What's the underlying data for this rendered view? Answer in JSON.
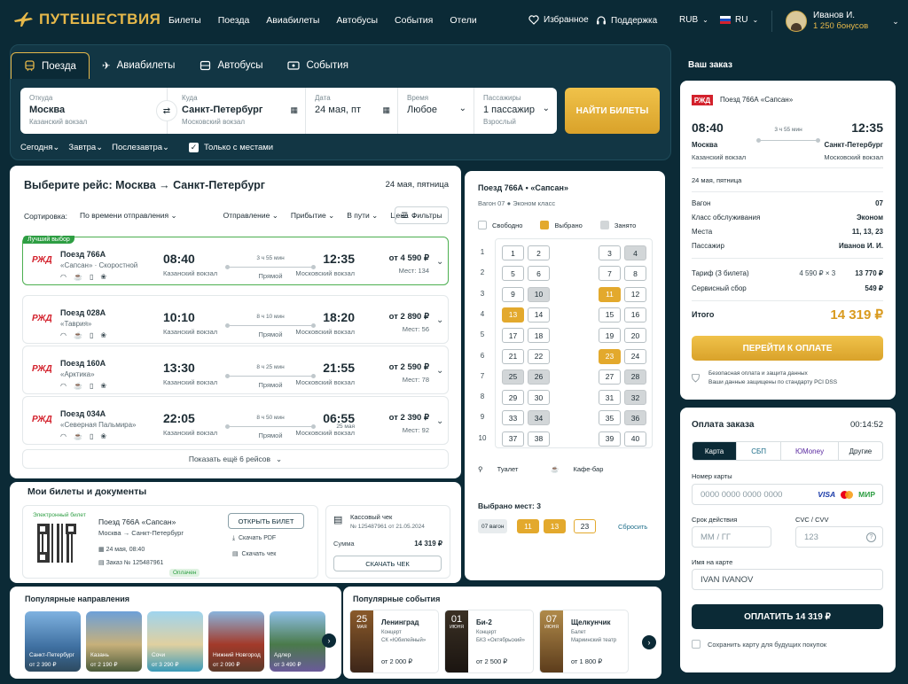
{
  "header": {
    "logo": "ПУТЕШЕСТВИЯ",
    "nav": [
      "Билеты",
      "Поезда",
      "Авиабилеты",
      "Автобусы",
      "События",
      "Отели"
    ],
    "favorites": "Избранное",
    "support": "Поддержка",
    "currency": "RUB",
    "lang": "RU",
    "user_name": "Иванов И.",
    "user_bonus": "1 250 бонусов"
  },
  "search": {
    "tabs": [
      "Поезда",
      "Авиабилеты",
      "Автобусы",
      "События"
    ],
    "from_label": "Откуда",
    "from": "Москва",
    "from_sub": "Казанский вокзал",
    "to_label": "Куда",
    "to": "Санкт-Петербург",
    "to_sub": "Московский вокзал",
    "date_label": "Дата",
    "date": "24 мая, пт",
    "time_label": "Время",
    "time": "Любое",
    "pass_label": "Пассажиры",
    "pass": "1 пассажир",
    "pass_sub": "Взрослый",
    "find": "НАЙТИ БИЛЕТЫ",
    "quick": [
      "Сегодня",
      "Завтра",
      "Послезавтра"
    ],
    "seats_only": "Только с местами"
  },
  "results": {
    "title": "Выберите рейс: Москва → Санкт-Петербург",
    "date": "24 мая, пятница",
    "sort_label": "Сортировка:",
    "sort_value": "По времени отправления",
    "sort_opts": [
      "Отправление",
      "Прибытие",
      "В пути",
      "Цена"
    ],
    "filters": "Фильтры",
    "best": "Лучший выбор",
    "trains": [
      {
        "name": "Поезд 766А",
        "sub": "«Сапсан» · Скоростной",
        "dep": "08:40",
        "dep_st": "Казанский вокзал",
        "dur": "3 ч 55 мин",
        "type": "Прямой",
        "arr": "12:35",
        "arr_day": "",
        "arr_st": "Московский вокзал",
        "price": "от 4 590 ₽",
        "seats": "Мест: 134"
      },
      {
        "name": "Поезд 028А",
        "sub": "«Таврия»",
        "dep": "10:10",
        "dep_st": "Казанский вокзал",
        "dur": "8 ч 10 мин",
        "type": "Прямой",
        "arr": "18:20",
        "arr_day": "",
        "arr_st": "Московский вокзал",
        "price": "от 2 890 ₽",
        "seats": "Мест: 56"
      },
      {
        "name": "Поезд 160А",
        "sub": "«Арктика»",
        "dep": "13:30",
        "dep_st": "Казанский вокзал",
        "dur": "8 ч 25 мин",
        "type": "Прямой",
        "arr": "21:55",
        "arr_day": "",
        "arr_st": "Московский вокзал",
        "price": "от 2 590 ₽",
        "seats": "Мест: 78"
      },
      {
        "name": "Поезд 034А",
        "sub": "«Северная Пальмира»",
        "dep": "22:05",
        "dep_st": "Казанский вокзал",
        "dur": "8 ч 50 мин",
        "type": "Прямой",
        "arr": "06:55",
        "arr_day": "25 мая",
        "arr_st": "Московский вокзал",
        "price": "от 2 390 ₽",
        "seats": "Мест: 92"
      }
    ],
    "more": "Показать ещё 6 рейсов"
  },
  "tickets": {
    "title": "Мои билеты и документы",
    "etk": "Электронный билет",
    "train": "Поезд 766А «Сапсан»",
    "route": "Москва → Санкт-Петербург",
    "when": "24 мая, 08:40",
    "order": "Заказ № 125487961",
    "status": "Оплачен",
    "open": "ОТКРЫТЬ БИЛЕТ",
    "pdf": "Скачать PDF",
    "check": "Скачать чек",
    "cash_title": "Кассовый чек",
    "cash_no": "№ 125487961 от 21.05.2024",
    "sum_label": "Сумма",
    "sum": "14 319 ₽",
    "cash_btn": "СКАЧАТЬ ЧЕК"
  },
  "popular": {
    "title": "Популярные направления",
    "items": [
      {
        "city": "Санкт-Петербург",
        "price": "от 2 390 ₽"
      },
      {
        "city": "Казань",
        "price": "от 2 190 ₽"
      },
      {
        "city": "Сочи",
        "price": "от 3 290 ₽"
      },
      {
        "city": "Нижний Новгород",
        "price": "от 2 090 ₽"
      },
      {
        "city": "Адлер",
        "price": "от 3 490 ₽"
      }
    ]
  },
  "events": {
    "title": "Популярные события",
    "items": [
      {
        "day": "25",
        "mon": "МАЯ",
        "name": "Ленинград",
        "kind": "Концерт",
        "place": "СК «Юбилейный»",
        "price": "от 2 000 ₽"
      },
      {
        "day": "01",
        "mon": "ИЮНЯ",
        "name": "Би-2",
        "kind": "Концерт",
        "place": "БКЗ «Октябрьский»",
        "price": "от 2 500 ₽"
      },
      {
        "day": "07",
        "mon": "ИЮНЯ",
        "name": "Щелкунчик",
        "kind": "Балет",
        "place": "Мариинский театр",
        "price": "от 1 800 ₽"
      }
    ]
  },
  "seatmap": {
    "title": "Поезд 766А • «Сапсан»",
    "car": "Вагон 07",
    "car_class": "Эконом класс",
    "legend": [
      "Свободно",
      "Выбрано",
      "Занято"
    ],
    "toilet": "Туалет",
    "cafe": "Кафе-бар",
    "selected_title": "Выбрано мест: 3",
    "car_chip": "07 вагон",
    "chosen": [
      "11",
      "13",
      "23"
    ],
    "reset": "Сбросить",
    "rows": [
      "1",
      "2",
      "3",
      "4",
      "5",
      "6",
      "7",
      "8",
      "9",
      "10"
    ],
    "left": [
      [
        "1",
        "2"
      ],
      [
        "5",
        "6"
      ],
      [
        "9",
        "10"
      ],
      [
        "13",
        "14"
      ],
      [
        "17",
        "18"
      ],
      [
        "21",
        "22"
      ],
      [
        "25",
        "26"
      ],
      [
        "29",
        "30"
      ],
      [
        "33",
        "34"
      ],
      [
        "37",
        "38"
      ]
    ],
    "right": [
      [
        "3",
        "4"
      ],
      [
        "7",
        "8"
      ],
      [
        "11",
        "12"
      ],
      [
        "15",
        "16"
      ],
      [
        "19",
        "20"
      ],
      [
        "23",
        "24"
      ],
      [
        "27",
        "28"
      ],
      [
        "31",
        "32"
      ],
      [
        "35",
        "36"
      ],
      [
        "39",
        "40"
      ]
    ],
    "busy": [
      "4",
      "10",
      "25",
      "26",
      "28",
      "32",
      "34",
      "36"
    ],
    "sel": [
      "11",
      "13",
      "23"
    ]
  },
  "order": {
    "title": "Ваш заказ",
    "train": "Поезд 766А «Сапсан»",
    "dep": "08:40",
    "arr": "12:35",
    "dur": "3 ч 55 мин",
    "from": "Москва",
    "from_st": "Казанский вокзал",
    "to": "Санкт-Петербург",
    "to_st": "Московский вокзал",
    "date": "24 мая, пятница",
    "lines": [
      {
        "k": "Вагон",
        "v": "07"
      },
      {
        "k": "Класс обслуживания",
        "v": "Эконом"
      },
      {
        "k": "Места",
        "v": "11, 13, 23"
      },
      {
        "k": "Пассажир",
        "v": "Иванов И. И."
      }
    ],
    "tariff_label": "Тариф (3 билета)",
    "tariff_calc": "4 590 ₽ × 3",
    "tariff": "13 770 ₽",
    "fee_label": "Сервисный сбор",
    "fee": "549 ₽",
    "total_label": "Итого",
    "total": "14 319 ₽",
    "pay": "ПЕРЕЙТИ К ОПЛАТЕ",
    "secure1": "Безопасная оплата и защита данных",
    "secure2": "Ваши данные защищены по стандарту PCI DSS"
  },
  "payment": {
    "title": "Оплата заказа",
    "timer": "00:14:52",
    "methods": [
      "Карта",
      "СБП",
      "ЮMoney",
      "Другие"
    ],
    "card_label": "Номер карты",
    "card_ph": "0000 0000 0000 0000",
    "exp_label": "Срок действия",
    "exp_ph": "ММ / ГГ",
    "cvc_label": "CVC / CVV",
    "cvc_ph": "123",
    "name_label": "Имя на карте",
    "name_val": "IVAN IVANOV",
    "pay": "ОПЛАТИТЬ 14 319 ₽",
    "save": "Сохранить карту для будущих покупок",
    "brands": [
      "VISA",
      "МИР"
    ]
  },
  "colors": {
    "dark": "#0b2a36",
    "gold": "#e3a92d",
    "green": "#2e9e43",
    "red": "#d3212c"
  }
}
